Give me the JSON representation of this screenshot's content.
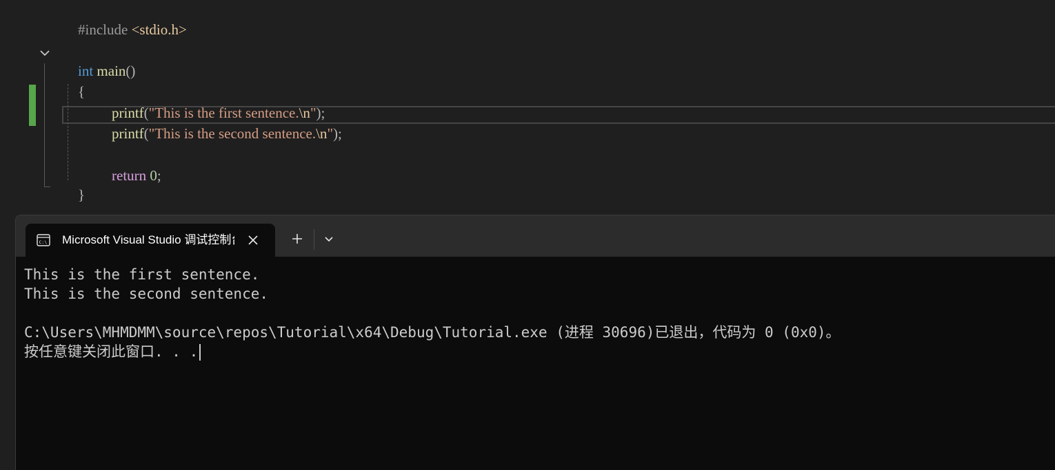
{
  "editor": {
    "include_directive": "#include",
    "include_header": "<stdio.h>",
    "main_keyword": "int",
    "main_name": "main",
    "main_parens": "()",
    "open_brace": "{",
    "close_brace": "}",
    "line1": {
      "fn": "printf",
      "open": "(",
      "str": "\"This is the first sentence.",
      "esc": "\\n",
      "close_quote": "\"",
      "end": ");"
    },
    "line2": {
      "fn": "printf",
      "open": "(",
      "str": "\"This is the second sentence.",
      "esc": "\\n",
      "close_quote": "\"",
      "end": ");"
    },
    "return_keyword": "return",
    "return_value": "0",
    "return_end": ";"
  },
  "terminal": {
    "tab_title": "Microsoft Visual Studio 调试控制台",
    "tab_icon": "console-icon",
    "new_tab_icon": "plus-icon",
    "dropdown_icon": "chevron-down-icon",
    "close_icon": "close-icon",
    "output": [
      "This is the first sentence.",
      "This is the second sentence.",
      "",
      "C:\\Users\\MHMDMM\\source\\repos\\Tutorial\\x64\\Debug\\Tutorial.exe (进程 30696)已退出，代码为 0 (0x0)。",
      "按任意键关闭此窗口. . ."
    ]
  },
  "colors": {
    "keyword": "#569cd6",
    "function": "#dcdcaa",
    "string": "#d69d85",
    "return_keyword": "#d8a0df",
    "number": "#b5cea8",
    "change_bar": "#57a64a",
    "console_bg": "#0c0c0c"
  }
}
